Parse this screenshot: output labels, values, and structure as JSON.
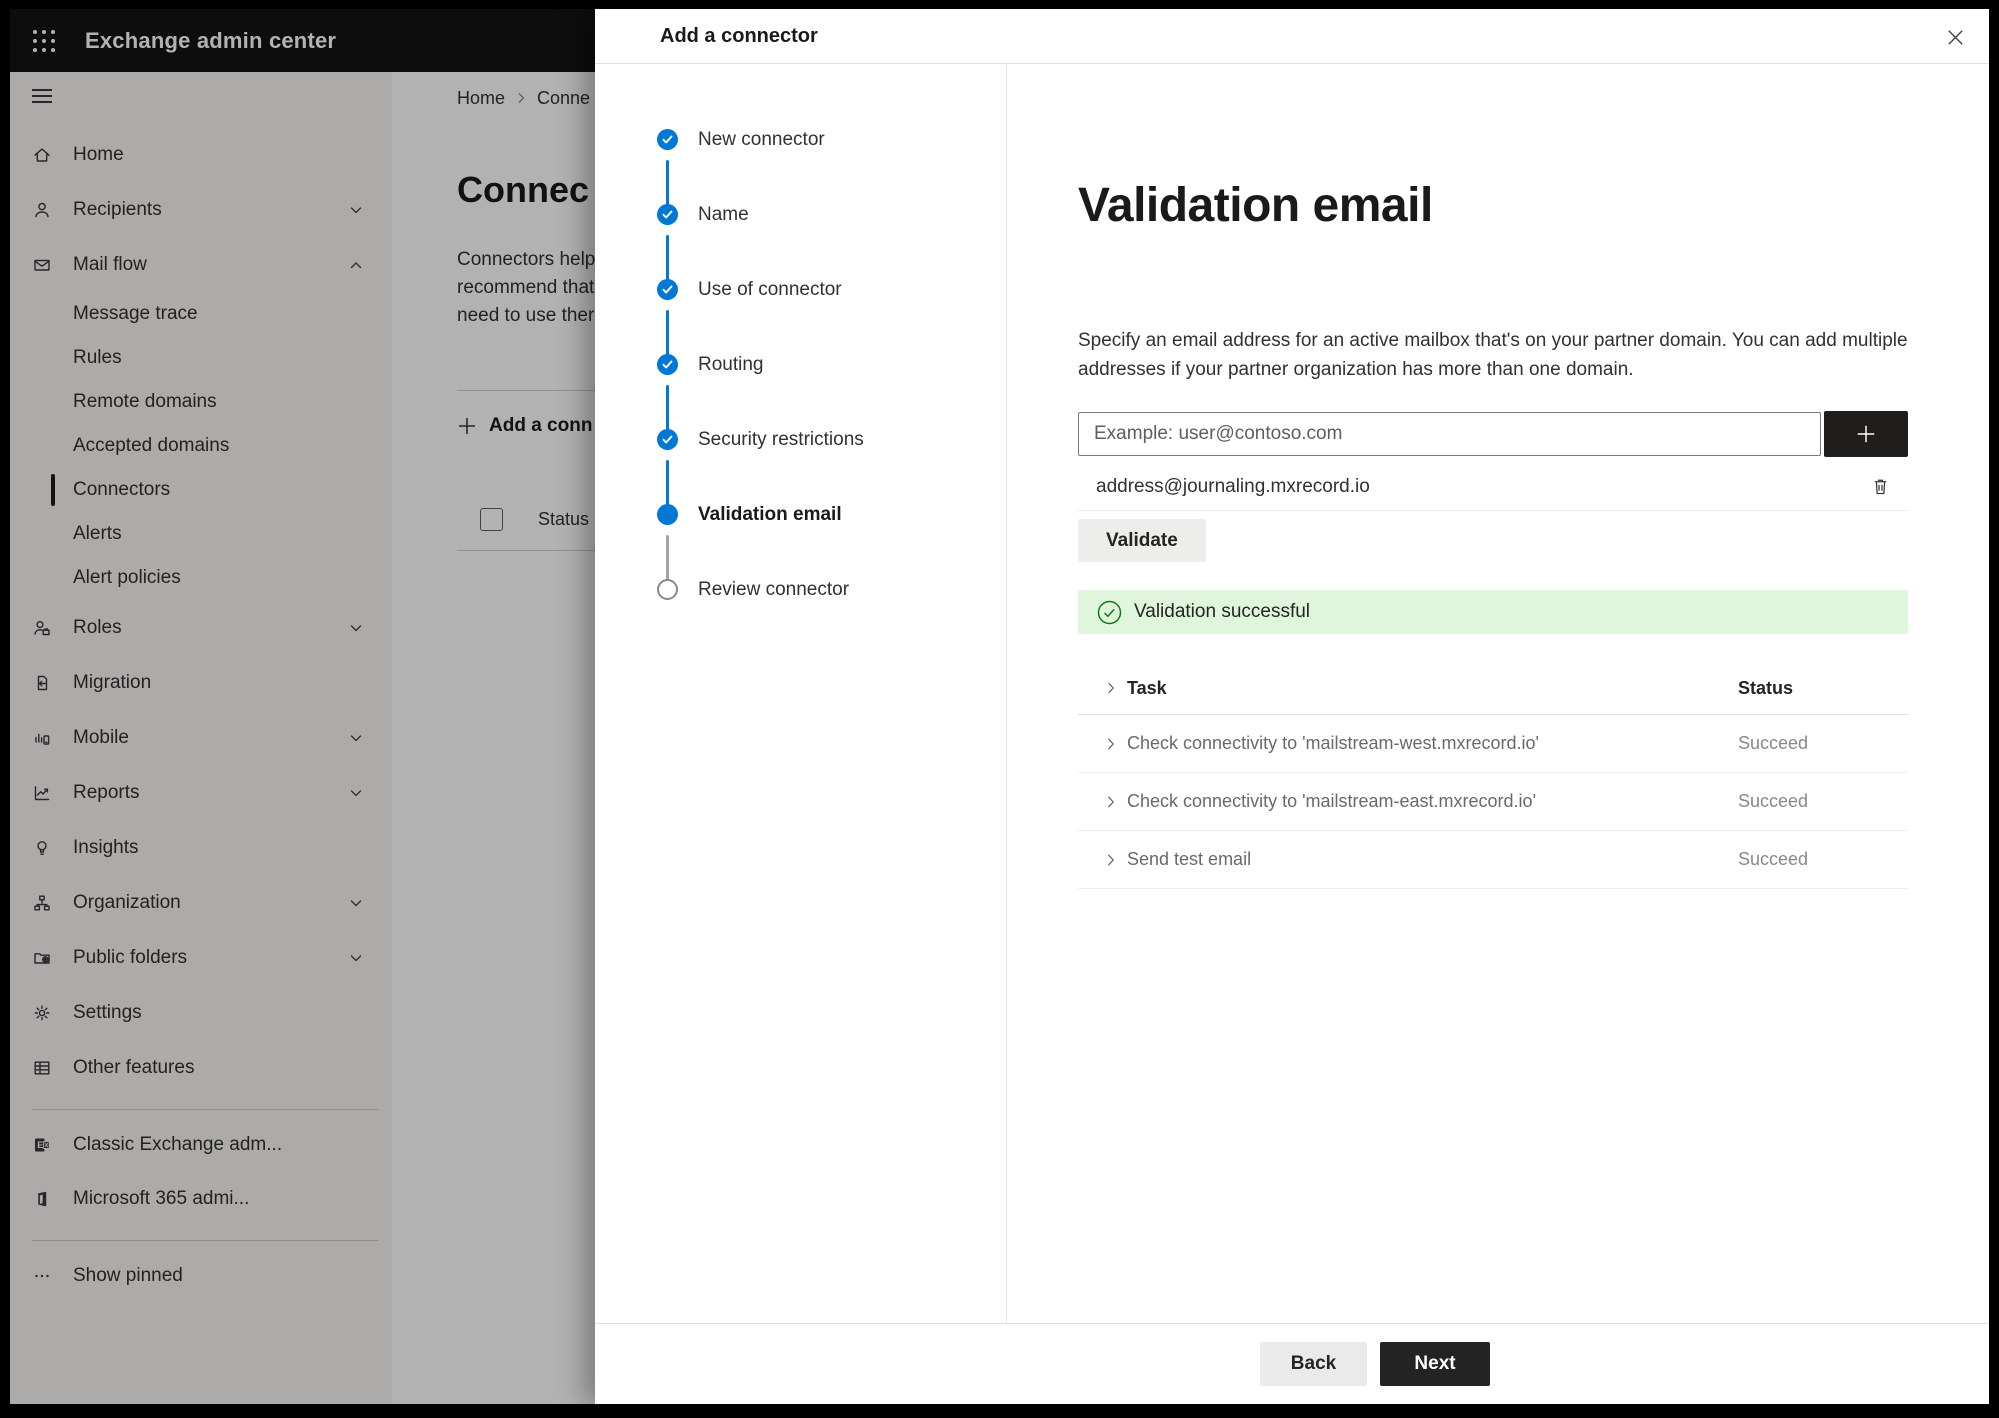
{
  "colors": {
    "accent": "#0078d4",
    "success": "#107c10",
    "success-bg": "#dff6dd",
    "divider": "#e3e1df",
    "text": "#323130",
    "text-strong": "#1b1a19",
    "text-muted": "#605e5c"
  },
  "app_header": {
    "title": "Exchange admin center"
  },
  "icons": {
    "app-launcher": "3x3-dot-grid",
    "hamburger": "three-lines",
    "close": "x-cross",
    "add": "plus",
    "delete": "trash-can",
    "expand-row": "chevron-right",
    "success-check": "check-circle",
    "step-complete": "check",
    "collapse": "chevron-up",
    "expand": "chevron-down",
    "breadcrumb-separator": "chevron-right",
    "show-pinned": "ellipsis"
  },
  "sidebar": {
    "items": [
      {
        "label": "Home",
        "icon": "home-icon",
        "level": "main"
      },
      {
        "label": "Recipients",
        "icon": "person-icon",
        "level": "main",
        "chevron": "down"
      },
      {
        "label": "Mail flow",
        "icon": "mail-icon",
        "level": "main",
        "chevron": "up"
      },
      {
        "label": "Message trace",
        "level": "sub"
      },
      {
        "label": "Rules",
        "level": "sub"
      },
      {
        "label": "Remote domains",
        "level": "sub"
      },
      {
        "label": "Accepted domains",
        "level": "sub"
      },
      {
        "label": "Connectors",
        "level": "sub",
        "selected": true
      },
      {
        "label": "Alerts",
        "level": "sub"
      },
      {
        "label": "Alert policies",
        "level": "sub"
      },
      {
        "label": "Roles",
        "icon": "roles-icon",
        "level": "main",
        "chevron": "down"
      },
      {
        "label": "Migration",
        "icon": "migration-icon",
        "level": "main"
      },
      {
        "label": "Mobile",
        "icon": "mobile-icon",
        "level": "main",
        "chevron": "down"
      },
      {
        "label": "Reports",
        "icon": "reports-icon",
        "level": "main",
        "chevron": "down"
      },
      {
        "label": "Insights",
        "icon": "insights-icon",
        "level": "main"
      },
      {
        "label": "Organization",
        "icon": "organization-icon",
        "level": "main",
        "chevron": "down"
      },
      {
        "label": "Public folders",
        "icon": "public-folders-icon",
        "level": "main",
        "chevron": "down"
      },
      {
        "label": "Settings",
        "icon": "settings-icon",
        "level": "main"
      },
      {
        "label": "Other features",
        "icon": "other-features-icon",
        "level": "main"
      }
    ],
    "footer_items": [
      {
        "label": "Classic Exchange adm...",
        "icon": "classic-exchange-icon"
      },
      {
        "label": "Microsoft 365 admi...",
        "icon": "microsoft-365-icon"
      }
    ],
    "show_pinned": {
      "label": "Show pinned",
      "icon": "ellipsis-icon"
    }
  },
  "background_page": {
    "breadcrumb": {
      "home": "Home",
      "current": "Conne"
    },
    "title": "Connec",
    "paragraph_lines": [
      "Connectors help",
      "recommend that",
      "need to use ther"
    ],
    "add_button": "Add a conn",
    "list_header": "Status"
  },
  "dialog": {
    "title": "Add a connector",
    "steps": [
      {
        "label": "New connector",
        "state": "done",
        "connector": "blue"
      },
      {
        "label": "Name",
        "state": "done",
        "connector": "blue"
      },
      {
        "label": "Use of connector",
        "state": "done",
        "connector": "blue"
      },
      {
        "label": "Routing",
        "state": "done",
        "connector": "blue"
      },
      {
        "label": "Security restrictions",
        "state": "done",
        "connector": "blue"
      },
      {
        "label": "Validation email",
        "state": "active",
        "connector": "gray"
      },
      {
        "label": "Review connector",
        "state": "todo",
        "connector": "none"
      }
    ],
    "content": {
      "heading": "Validation email",
      "description": "Specify an email address for an active mailbox that's on your partner domain. You can add multiple addresses if your partner organization has more than one domain.",
      "input_placeholder": "Example: user@contoso.com",
      "added_address": "address@journaling.mxrecord.io",
      "validate_button": "Validate",
      "success_message": "Validation successful",
      "table": {
        "headers": {
          "task": "Task",
          "status": "Status"
        },
        "rows": [
          {
            "task": "Check connectivity to 'mailstream-west.mxrecord.io'",
            "status": "Succeed"
          },
          {
            "task": "Check connectivity to 'mailstream-east.mxrecord.io'",
            "status": "Succeed"
          },
          {
            "task": "Send test email",
            "status": "Succeed"
          }
        ]
      }
    },
    "footer": {
      "back": "Back",
      "next": "Next"
    }
  }
}
